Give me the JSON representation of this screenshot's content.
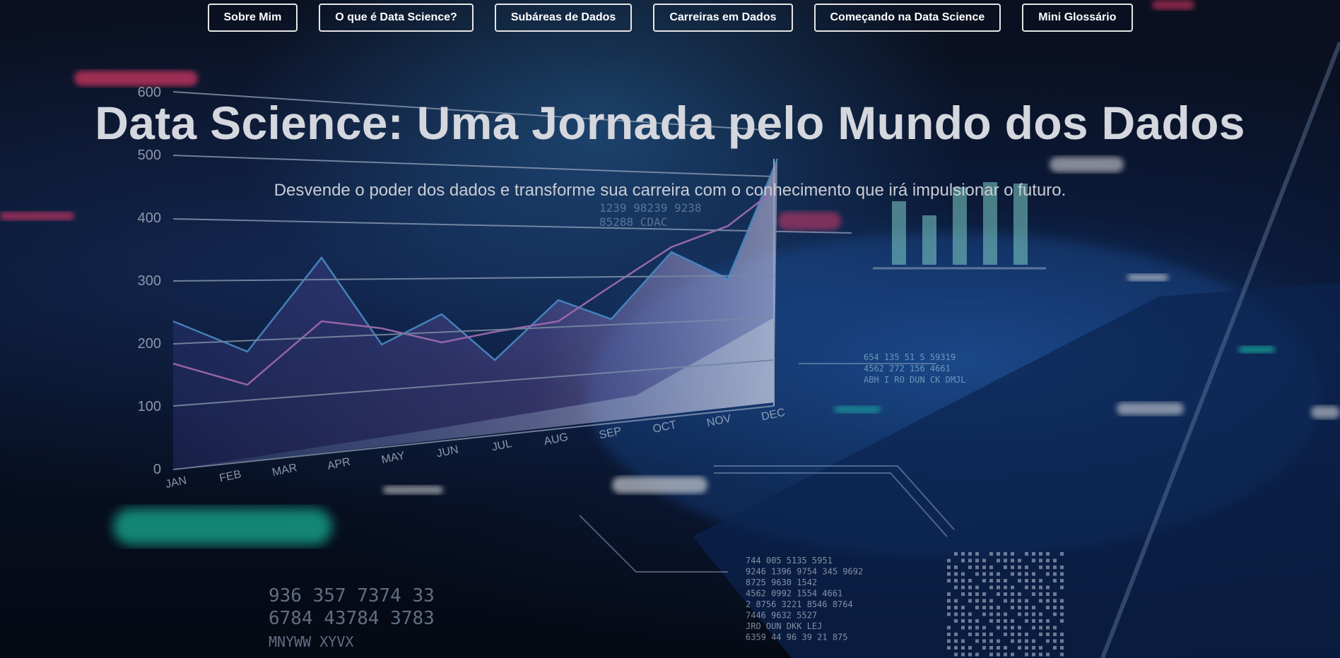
{
  "nav": {
    "items": [
      {
        "label": "Sobre Mim"
      },
      {
        "label": "O que é Data Science?"
      },
      {
        "label": "Subáreas de Dados"
      },
      {
        "label": "Carreiras em Dados"
      },
      {
        "label": "Começando na Data Science"
      },
      {
        "label": "Mini Glossário"
      }
    ]
  },
  "hero": {
    "title": "Data Science: Uma Jornada pelo Mundo dos Dados",
    "subtitle": "Desvende o poder dos dados e transforme sua carreira com o conhecimento que irá impulsionar o futuro."
  },
  "background": {
    "chart": {
      "y_ticks": [
        "600",
        "500",
        "400",
        "300",
        "200",
        "100",
        "0"
      ],
      "x_ticks": [
        "JAN",
        "FEB",
        "MAR",
        "APR",
        "MAY",
        "JUN",
        "JUL",
        "AUG",
        "SEP",
        "OCT",
        "NOV",
        "DEC"
      ]
    },
    "numbers_bottom_left": [
      "936  357  7374  33",
      "6784  43784  3783",
      "MNYWW XYVX"
    ],
    "numbers_bottom_center": [
      "744  005  5135  5951",
      "9246 1396 9754 345 9692",
      "8725 9630 1542",
      "4562  0992  1554  4661",
      "2 8756 3221 8546 8764",
      "7446 9632 5527",
      "JRO OUN  DKK LEJ",
      "6359 44 96 39 21 875"
    ],
    "numbers_right": [
      "654  135  51 5  59319",
      "4562  272  156  4661",
      "ABH I RO DUN  CK DMJL"
    ],
    "numbers_top": [
      "1239  98239  9238",
      "85288 CDAC"
    ]
  },
  "colors": {
    "nav_border": "#e6e6e6",
    "title": "#d4d7de",
    "subtitle": "#c9ccd4",
    "accent_teal": "#1fd6b4",
    "accent_pink": "#ff3d6e"
  }
}
